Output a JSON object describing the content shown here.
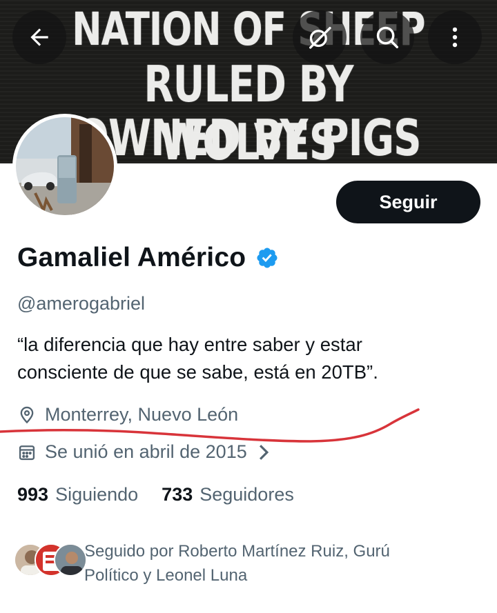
{
  "banner": {
    "line1": "NATION OF SHEEP",
    "line2": "RULED BY WOLVES",
    "line3": "OWNED BY PIGS"
  },
  "toolbar": {
    "back_icon": "arrow-left-icon",
    "grok_icon": "grok-icon",
    "search_icon": "search-icon",
    "more_icon": "more-vertical-icon"
  },
  "profile": {
    "name": "Gamaliel Américo",
    "handle": "@amerogabriel",
    "bio_line1": "“la diferencia que hay entre saber y estar",
    "bio_line2": "consciente de que se sabe,  está en 20TB”.",
    "location": "Monterrey, Nuevo León",
    "joined": "Se unió en abril de 2015",
    "verified_color": "#1d9bf0"
  },
  "actions": {
    "follow_label": "Seguir"
  },
  "stats": {
    "following_count": "993",
    "following_label": "Siguiendo",
    "followers_count": "733",
    "followers_label": "Seguidores"
  },
  "followed_by": {
    "text": "Seguido por Roberto Martínez Ruiz, Gurú Político y Leonel Luna"
  },
  "colors": {
    "annotation": "#d8343a",
    "text_primary": "#0f1419",
    "text_secondary": "#536471"
  }
}
